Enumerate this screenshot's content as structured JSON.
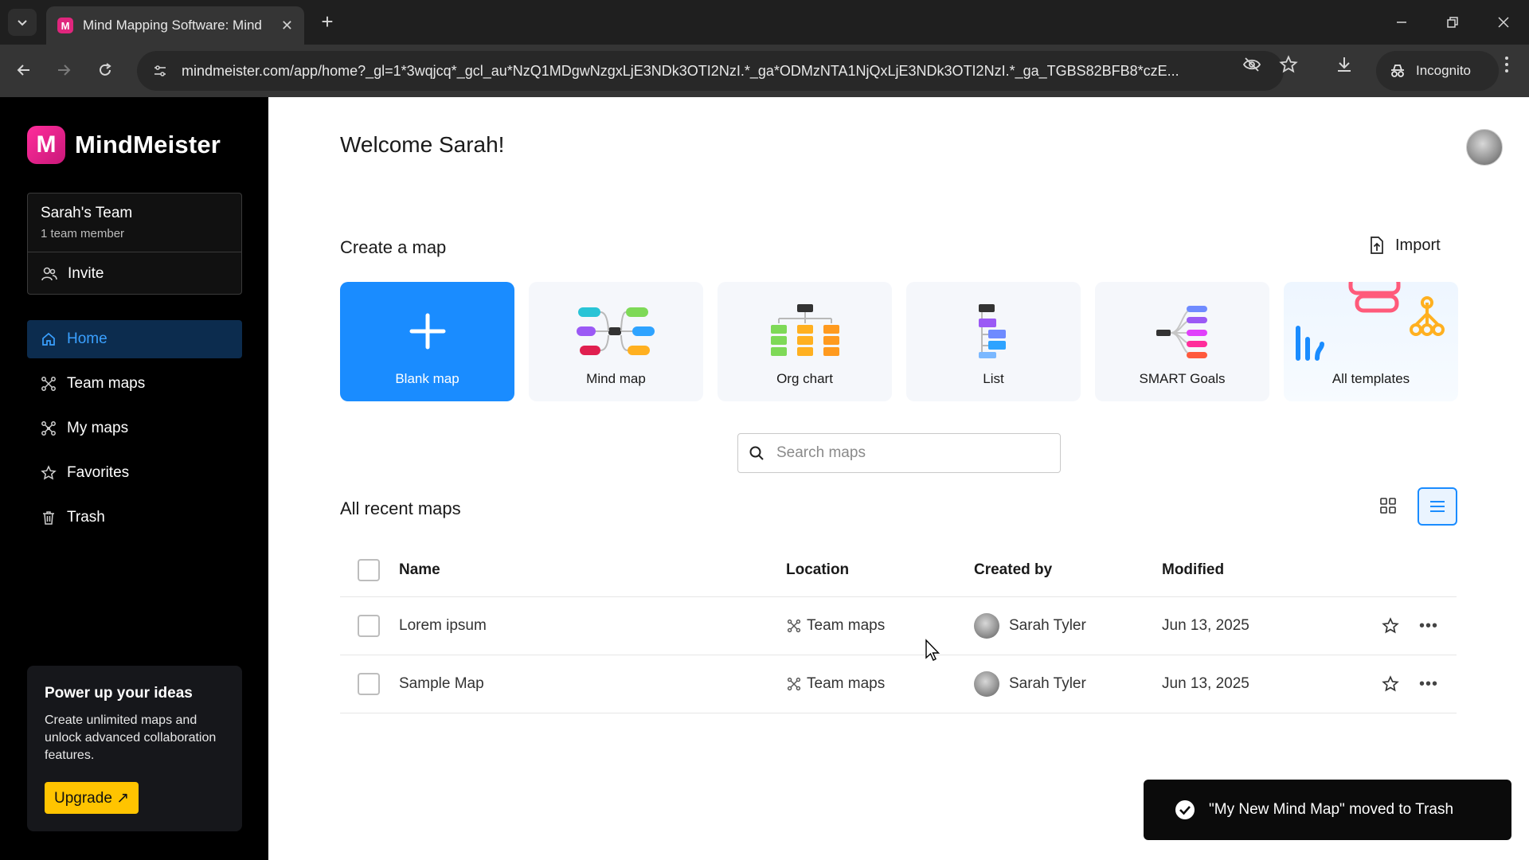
{
  "browser": {
    "tab_title": "Mind Mapping Software: Mind",
    "tab_favicon": "M",
    "url": "mindmeister.com/app/home?_gl=1*3wqjcq*_gcl_au*NzQ1MDgwNzgxLjE3NDk3OTI2NzI.*_ga*ODMzNTA1NjQxLjE3NDk3OTI2NzI.*_ga_TGBS82BFB8*czE...",
    "incognito_label": "Incognito"
  },
  "sidebar": {
    "brand_name": "MindMeister",
    "brand_logo_letter": "M",
    "team": {
      "name": "Sarah's Team",
      "members": "1 team member",
      "invite_label": "Invite"
    },
    "nav": [
      {
        "label": "Home",
        "icon": "home-icon",
        "active": true
      },
      {
        "label": "Team maps",
        "icon": "team-maps-icon",
        "active": false
      },
      {
        "label": "My maps",
        "icon": "my-maps-icon",
        "active": false
      },
      {
        "label": "Favorites",
        "icon": "star-icon",
        "active": false
      },
      {
        "label": "Trash",
        "icon": "trash-icon",
        "active": false
      }
    ],
    "promo": {
      "title": "Power up your ideas",
      "text": "Create unlimited maps and unlock advanced collaboration features.",
      "button": "Upgrade ↗"
    }
  },
  "main": {
    "welcome": "Welcome Sarah!",
    "create_title": "Create a map",
    "import_label": "Import",
    "cards": [
      {
        "label": "Blank map",
        "icon": "plus-icon"
      },
      {
        "label": "Mind map",
        "icon": "mind-map-icon"
      },
      {
        "label": "Org chart",
        "icon": "org-chart-icon"
      },
      {
        "label": "List",
        "icon": "list-icon"
      },
      {
        "label": "SMART Goals",
        "icon": "smart-goals-icon"
      },
      {
        "label": "All templates",
        "icon": "templates-icon"
      }
    ],
    "search_placeholder": "Search maps",
    "recent_title": "All recent maps",
    "table": {
      "headers": {
        "name": "Name",
        "location": "Location",
        "created_by": "Created by",
        "modified": "Modified"
      },
      "rows": [
        {
          "name": "Lorem ipsum",
          "location": "Team maps",
          "created_by": "Sarah Tyler",
          "modified": "Jun 13, 2025"
        },
        {
          "name": "Sample Map",
          "location": "Team maps",
          "created_by": "Sarah Tyler",
          "modified": "Jun 13, 2025"
        }
      ]
    },
    "toast": "\"My New Mind Map\" moved to Trash"
  },
  "colors": {
    "accent": "#1a8cff",
    "brand": "#e0267d",
    "upgrade": "#ffc400",
    "sidebar_bg": "#000000"
  }
}
